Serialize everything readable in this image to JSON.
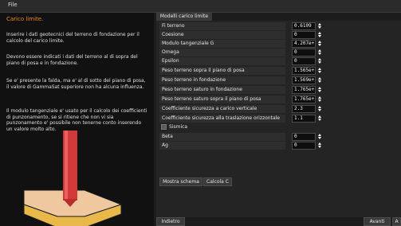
{
  "menu": {
    "file_label": "File"
  },
  "left": {
    "title": "Carico limite.",
    "paragraphs": [
      "Inserire i dati geotecnici del terreno di fondazione per il calcolo del carico limite.",
      "Devono essere indicati i dati del terreno al di sopra del piano di posa e in fondazione.",
      "Se e' presente la falda, ma e' al di sotto del piano di posa, il valore di GammaSat superiore non ha alcuna influenza.",
      "Il modulo tangenziale e' usato per il calcolo dei coefficienti di punzonamento, se si ritiene che non vi sia punzonamento e' possibile non tenerne conto inserendo un valore molto alto."
    ]
  },
  "tab": {
    "label": "Modelli carico limite"
  },
  "fields": [
    {
      "label": "Fi terreno",
      "value": "0.6109"
    },
    {
      "label": "Coesione",
      "value": "0"
    },
    {
      "label": "Modulo tangenziale G",
      "value": "4.207e+"
    },
    {
      "label": "Omega",
      "value": "0"
    },
    {
      "label": "Epsilon",
      "value": "0"
    },
    {
      "label": "Peso terreno sopra il piano di posa",
      "value": "1.565e+"
    },
    {
      "label": "Peso terreno in fondazione",
      "value": "1.569e+"
    },
    {
      "label": "Peso terreno saturo in fondazione",
      "value": "1.765e+"
    },
    {
      "label": "Peso terreno saturo sopra il piano di posa",
      "value": "1.765e+"
    },
    {
      "label": "Coefficiente sicurezza a carico verticale",
      "value": "2.3"
    },
    {
      "label": "Coefficiente sicurezza alla traslazione orizzontale",
      "value": "1.1"
    }
  ],
  "sismica": {
    "label": "Sismica"
  },
  "seismic_fields": [
    {
      "label": "Beta",
      "value": "0"
    },
    {
      "label": "Ag",
      "value": "0"
    }
  ],
  "buttons": {
    "mostra_schema": "Mostra schema",
    "calcola_c": "Calcola C",
    "indietro": "Indietro",
    "avanti": "Avanti",
    "last": "A"
  },
  "colors": {
    "accent": "#f08a1c",
    "pile": "#d23a3a",
    "soil_upper": "#f0c8a0",
    "soil_lower": "#e8b84a"
  }
}
